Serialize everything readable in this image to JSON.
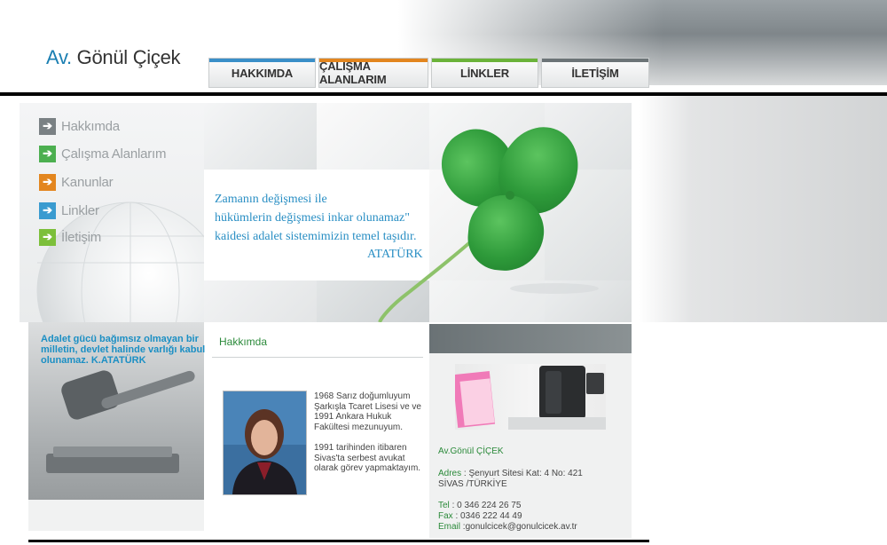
{
  "logo": {
    "prefix": "Av.",
    "name": "Gönül Çiçek"
  },
  "nav": [
    {
      "label": "HAKKIMDA",
      "color": "#3a8fc8"
    },
    {
      "label": "ÇALIŞMA ALANLARIM",
      "color": "#e3861f"
    },
    {
      "label": "LİNKLER",
      "color": "#6bb33a"
    },
    {
      "label": "İLETİŞİM",
      "color": "#6c7477"
    }
  ],
  "menu": [
    {
      "label": "Hakkımda",
      "color": "#7a8184"
    },
    {
      "label": "Çalışma Alanlarım",
      "color": "#4caf50"
    },
    {
      "label": "Kanunlar",
      "color": "#e3861f"
    },
    {
      "label": "Linkler",
      "color": "#3a9bd0"
    },
    {
      "label": "İletişim",
      "color": "#7cbf3a"
    }
  ],
  "banner_quote": {
    "line1": "Zamanın değişmesi ile",
    "line2": "hükümlerin değişmesi inkar olunamaz\"",
    "line3": "kaidesi adalet sistemimizin temel taşıdır.",
    "author": "ATATÜRK"
  },
  "side_quote": "Adalet gücü bağımsız olmayan bir milletin, devlet halinde varlığı kabul olunamaz. K.ATATÜRK",
  "about": {
    "title": "Hakkımda",
    "p1": "1968 Sarız doğumluyum Şarkışla Tcaret Lisesi ve ve 1991 Ankara Hukuk Fakültesi mezunuyum.",
    "p2": "1991 tarihinden itibaren Sivas'ta serbest avukat olarak görev yapmaktayım."
  },
  "contact": {
    "name": "Av.Gönül ÇİÇEK",
    "address_label": "Adres",
    "address_value": " : Şenyurt Sitesi Kat: 4 No: 421",
    "city": "SİVAS /TÜRKİYE",
    "tel_label": "Tel",
    "tel_value": " : 0 346 224 26 75",
    "fax_label": "Fax",
    "fax_value": " : 0346 222 44 49",
    "email_label": "Email",
    "email_value": " :gonulcicek@gonulcicek.av.tr"
  }
}
